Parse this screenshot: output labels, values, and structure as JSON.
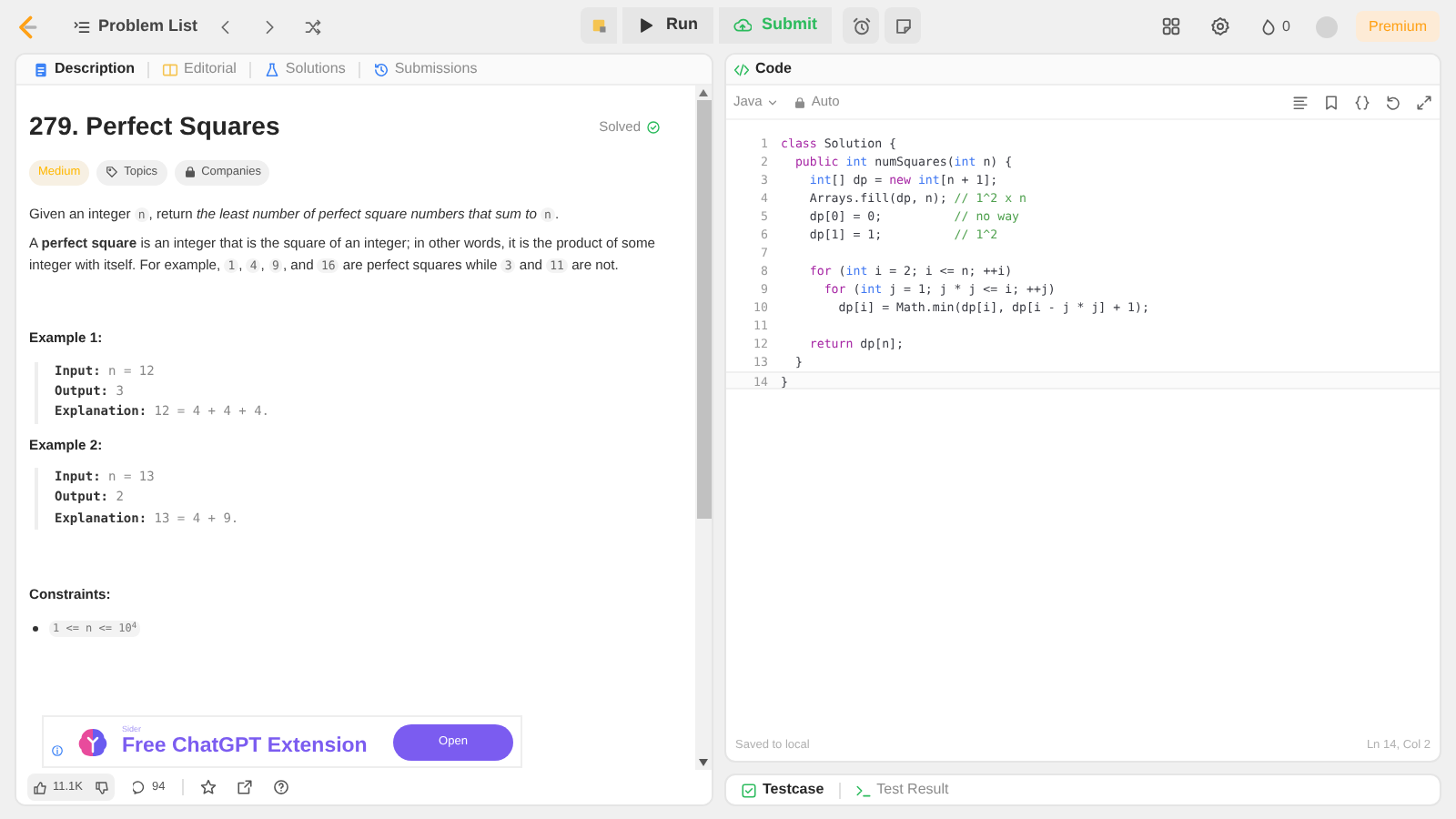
{
  "topbar": {
    "nav_label": "Problem List",
    "actions": [
      {
        "label": "Run",
        "kind": "run"
      },
      {
        "label": "Submit",
        "kind": "submit"
      }
    ],
    "streak": "0",
    "premium": "Premium"
  },
  "left_tabs": [
    {
      "label": "Description",
      "kind": "description",
      "selected": true
    },
    {
      "label": "Editorial",
      "kind": "editorial",
      "selected": false
    },
    {
      "label": "Solutions",
      "kind": "solutions",
      "selected": false
    },
    {
      "label": "Submissions",
      "kind": "submissions",
      "selected": false
    }
  ],
  "problem": {
    "title": "279. Perfect Squares",
    "status": "Solved",
    "difficulty": "Medium",
    "tags": [
      {
        "label": "Topics",
        "kind": "topics"
      },
      {
        "label": "Companies",
        "kind": "companies"
      }
    ],
    "paragraphs": [
      [
        {
          "text": "Given an integer ",
          "kind": "text"
        },
        {
          "text": "n",
          "kind": "code"
        },
        {
          "text": ", return ",
          "kind": "text"
        },
        {
          "text": "the least number of perfect square numbers that sum to ",
          "kind": "italic"
        },
        {
          "text": "n",
          "kind": "code"
        },
        {
          "text": ".",
          "kind": "text"
        }
      ],
      [
        {
          "text": "A ",
          "kind": "text"
        },
        {
          "text": "perfect square",
          "kind": "bold"
        },
        {
          "text": " is an integer that is the square of an integer; in other words, it is the product of some integer with itself. For example, ",
          "kind": "text"
        },
        {
          "text": "1",
          "kind": "code"
        },
        {
          "text": ", ",
          "kind": "text"
        },
        {
          "text": "4",
          "kind": "code"
        },
        {
          "text": ", ",
          "kind": "text"
        },
        {
          "text": "9",
          "kind": "code"
        },
        {
          "text": ", and ",
          "kind": "text"
        },
        {
          "text": "16",
          "kind": "code"
        },
        {
          "text": " are perfect squares while ",
          "kind": "text"
        },
        {
          "text": "3",
          "kind": "code"
        },
        {
          "text": " and ",
          "kind": "text"
        },
        {
          "text": "11",
          "kind": "code"
        },
        {
          "text": " are not.",
          "kind": "text"
        }
      ]
    ],
    "examples": [
      {
        "heading": "Example 1:",
        "lines": [
          {
            "label": "Input:",
            "value": "n = 12"
          },
          {
            "label": "Output:",
            "value": "3"
          },
          {
            "label": "Explanation:",
            "value": "12 = 4 + 4 + 4."
          }
        ]
      },
      {
        "heading": "Example 2:",
        "lines": [
          {
            "label": "Input:",
            "value": "n = 13"
          },
          {
            "label": "Output:",
            "value": "2"
          },
          {
            "label": "Explanation:",
            "value": "13 = 4 + 9."
          }
        ]
      }
    ],
    "constraints_heading": "Constraints:",
    "constraints": [
      "1 <= n <= 10$^{4}$"
    ]
  },
  "ad": {
    "brand": "Sider",
    "headline": "Free ChatGPT Extension",
    "button": "Open"
  },
  "footer": {
    "likes": "11.1K",
    "comments": "94"
  },
  "editor": {
    "tab": "Code",
    "language": "Java",
    "mode": "Auto",
    "save_status": "Saved to local",
    "cursor": "Ln 14, Col 2",
    "lines": [
      {
        "number": "1",
        "tokens": [
          {
            "text": "class",
            "kind": "kw"
          },
          {
            "text": " Solution {",
            "kind": "plain"
          }
        ]
      },
      {
        "number": "2",
        "tokens": [
          {
            "text": "  public",
            "kind": "kw"
          },
          {
            "text": " int",
            "kind": "type"
          },
          {
            "text": " numSquares(",
            "kind": "plain"
          },
          {
            "text": "int",
            "kind": "type"
          },
          {
            "text": " n) {",
            "kind": "plain"
          }
        ]
      },
      {
        "number": "3",
        "tokens": [
          {
            "text": "    int",
            "kind": "type"
          },
          {
            "text": "[] dp = ",
            "kind": "plain"
          },
          {
            "text": "new",
            "kind": "kw"
          },
          {
            "text": " int",
            "kind": "type"
          },
          {
            "text": "[n + 1];",
            "kind": "plain"
          }
        ]
      },
      {
        "number": "4",
        "tokens": [
          {
            "text": "    Arrays.fill(dp, n); ",
            "kind": "plain"
          },
          {
            "text": "// 1^2 x n",
            "kind": "comment"
          }
        ]
      },
      {
        "number": "5",
        "tokens": [
          {
            "text": "    dp[0] = 0;          ",
            "kind": "plain"
          },
          {
            "text": "// no way",
            "kind": "comment"
          }
        ]
      },
      {
        "number": "6",
        "tokens": [
          {
            "text": "    dp[1] = 1;          ",
            "kind": "plain"
          },
          {
            "text": "// 1^2",
            "kind": "comment"
          }
        ]
      },
      {
        "number": "7"
      },
      {
        "number": "8",
        "tokens": [
          {
            "text": "    for",
            "kind": "kw"
          },
          {
            "text": " (",
            "kind": "plain"
          },
          {
            "text": "int",
            "kind": "type"
          },
          {
            "text": " i = 2; i <= n; ++i)",
            "kind": "plain"
          }
        ]
      },
      {
        "number": "9",
        "tokens": [
          {
            "text": "      for",
            "kind": "kw"
          },
          {
            "text": " (",
            "kind": "plain"
          },
          {
            "text": "int",
            "kind": "type"
          },
          {
            "text": " j = 1; j * j <= i; ++j)",
            "kind": "plain"
          }
        ]
      },
      {
        "number": "10",
        "tokens": [
          {
            "text": "        dp[i] = Math.min(dp[i], dp[i - j * j] + 1);",
            "kind": "plain"
          }
        ]
      },
      {
        "number": "11"
      },
      {
        "number": "12",
        "tokens": [
          {
            "text": "    return",
            "kind": "kw"
          },
          {
            "text": " dp[n];",
            "kind": "plain"
          }
        ]
      },
      {
        "number": "13",
        "tokens": [
          {
            "text": "  }",
            "kind": "plain"
          }
        ]
      },
      {
        "number": "14",
        "tokens": [
          {
            "text": "}",
            "kind": "plain"
          }
        ]
      }
    ]
  },
  "bottom_tabs": [
    {
      "label": "Testcase",
      "kind": "testcase",
      "selected": true
    },
    {
      "label": "Test Result",
      "kind": "result",
      "selected": false
    }
  ]
}
